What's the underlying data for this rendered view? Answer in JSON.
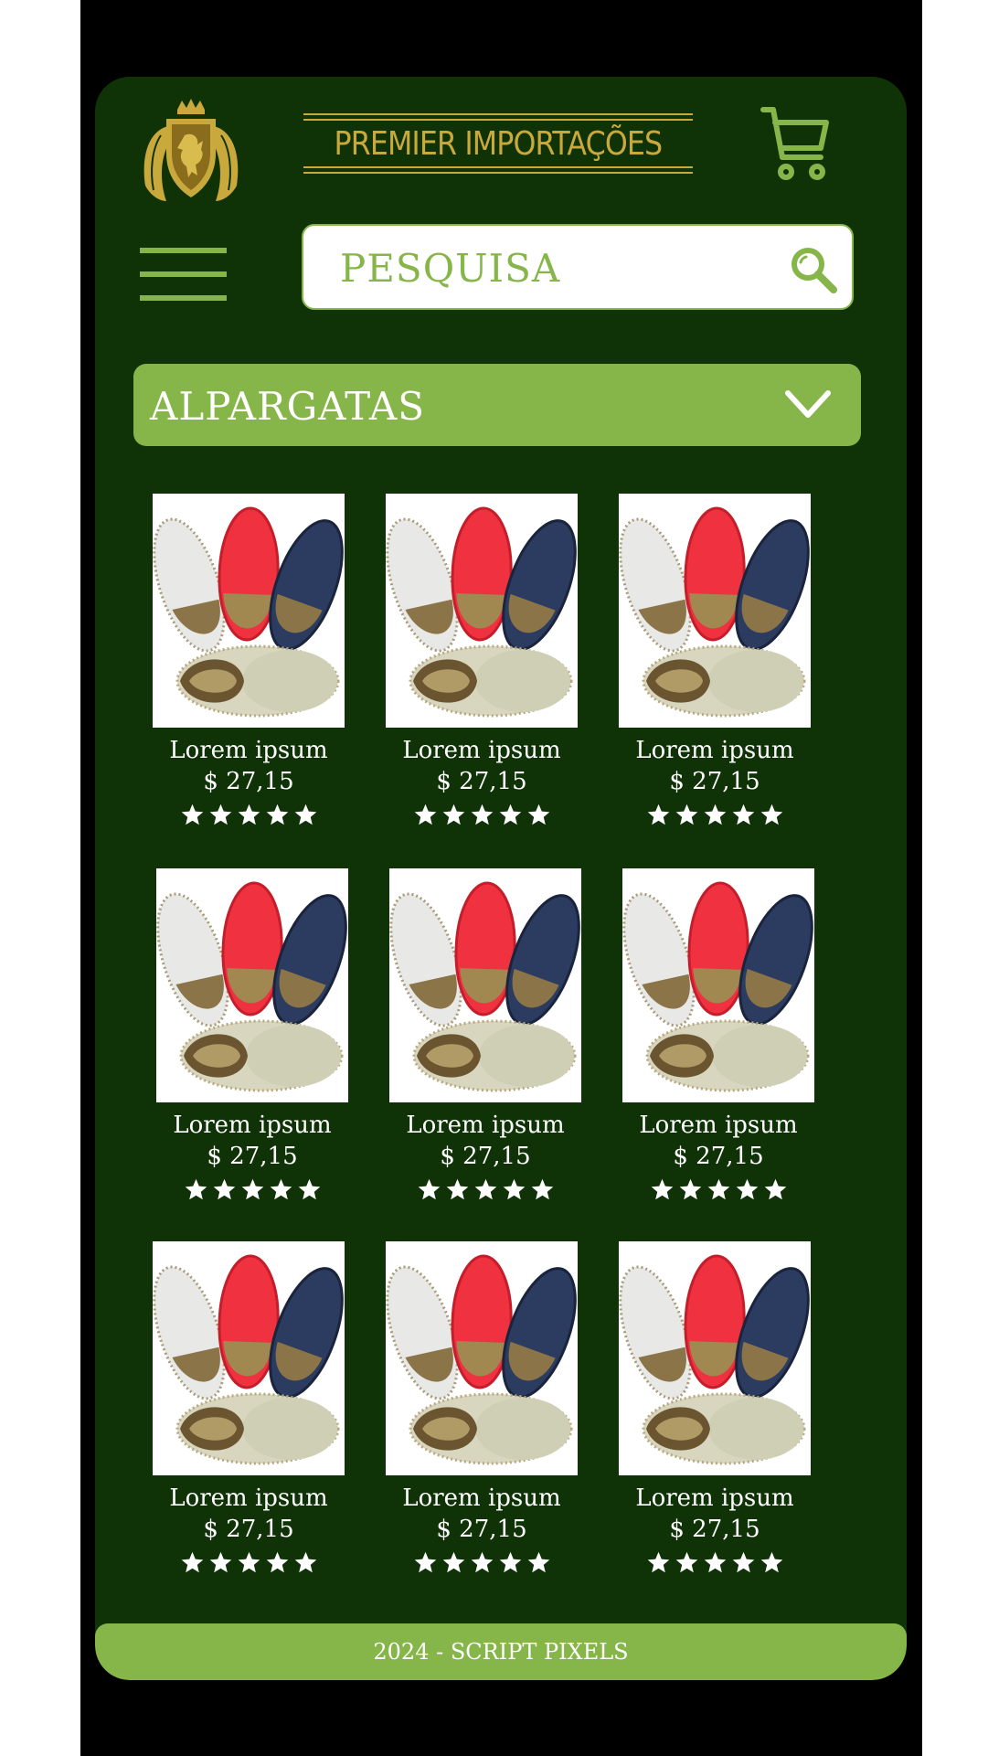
{
  "brand": {
    "name": "PREMIER IMPORTAÇÕES",
    "logo_icon": "griffin-crest-icon"
  },
  "header": {
    "cart_icon": "shopping-cart-icon",
    "menu_icon": "hamburger-menu-icon"
  },
  "search": {
    "placeholder": "PESQUISA",
    "value": "",
    "icon": "magnifier-icon"
  },
  "category": {
    "selected": "ALPARGATAS",
    "icon": "chevron-down-icon"
  },
  "products": [
    {
      "name": "Lorem ipsum",
      "price": "$ 27,15",
      "rating": 5,
      "image": "espadrilles-photo"
    },
    {
      "name": "Lorem ipsum",
      "price": "$ 27,15",
      "rating": 5,
      "image": "espadrilles-photo"
    },
    {
      "name": "Lorem ipsum",
      "price": "$ 27,15",
      "rating": 5,
      "image": "espadrilles-photo"
    },
    {
      "name": "Lorem ipsum",
      "price": "$ 27,15",
      "rating": 5,
      "image": "espadrilles-photo"
    },
    {
      "name": "Lorem ipsum",
      "price": "$ 27,15",
      "rating": 5,
      "image": "espadrilles-photo"
    },
    {
      "name": "Lorem ipsum",
      "price": "$ 27,15",
      "rating": 5,
      "image": "espadrilles-photo"
    },
    {
      "name": "Lorem ipsum",
      "price": "$ 27,15",
      "rating": 5,
      "image": "espadrilles-photo"
    },
    {
      "name": "Lorem ipsum",
      "price": "$ 27,15",
      "rating": 5,
      "image": "espadrilles-photo"
    },
    {
      "name": "Lorem ipsum",
      "price": "$ 27,15",
      "rating": 5,
      "image": "espadrilles-photo"
    }
  ],
  "footer": {
    "text": "2024 - SCRIPT PIXELS"
  },
  "colors": {
    "background": "#0f3307",
    "accent": "#86b64a",
    "gold": "#c9a93b",
    "frame": "#000000"
  }
}
